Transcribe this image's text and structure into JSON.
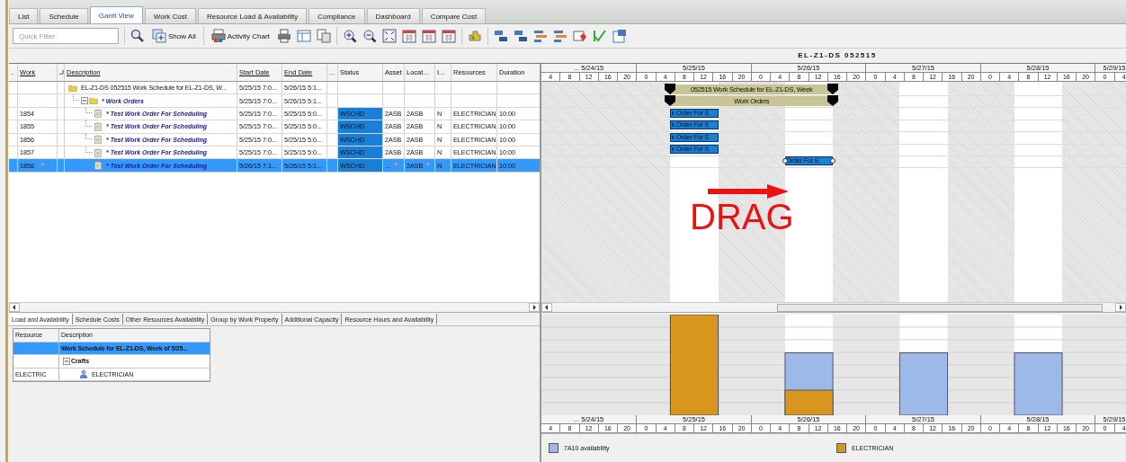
{
  "tabs": [
    {
      "label": "List",
      "selected": false
    },
    {
      "label": "Schedule",
      "selected": false
    },
    {
      "label": "Gantt View",
      "selected": true
    },
    {
      "label": "Work Cost",
      "selected": false
    },
    {
      "label": "Resource Load & Availability",
      "selected": false
    },
    {
      "label": "Compliance",
      "selected": false
    },
    {
      "label": "Dashboard",
      "selected": false
    },
    {
      "label": "Compare Cost",
      "selected": false
    }
  ],
  "toolbar": {
    "quick_filter": {
      "placeholder": "Quick Filter"
    },
    "buttons": [
      {
        "label": "Show All"
      },
      {
        "label": "Activity Chart"
      }
    ]
  },
  "schedule_title": "EL-Z1-DS 052515",
  "grid": {
    "columns": [
      {
        "label": ".."
      },
      {
        "label": "Work",
        "sortable": true
      },
      {},
      {
        "label": "Description",
        "sortable": true
      },
      {
        "label": "Start Date",
        "sortable": true
      },
      {
        "label": "End Date",
        "sortable": true
      },
      {
        "label": "..."
      },
      {
        "label": "Status"
      },
      {
        "label": "Asset"
      },
      {
        "label": "Locat..."
      },
      {
        "label": "I..."
      },
      {
        "label": "Resources"
      },
      {
        "label": "Duration"
      }
    ],
    "rows": [
      {
        "kind": "schedule",
        "selected": false,
        "description": "EL-Z1-DS 052515  Work Schedule for EL-Z1-DS, W...",
        "start": "5/25/15 7:0...",
        "end": "5/26/15 5:1...",
        "children": [
          {
            "kind": "group",
            "selected": false,
            "description": "* Work Orders",
            "start": "5/25/15 7:0...",
            "end": "5/26/15 5:1...",
            "children": [
              {
                "kind": "work_order",
                "selected": false,
                "work": "1854",
                "description": "* Test Work Order For Scheduling",
                "start": "5/25/15 7:0...",
                "end": "5/25/15 5:0...",
                "status": "WSCHD",
                "asset": "2ASB",
                "location": "2ASB",
                "i": "N",
                "resources": "ELECTRICIAN",
                "duration": "10:00",
                "linked": false
              },
              {
                "kind": "work_order",
                "selected": false,
                "work": "1855",
                "description": "* Test Work Order For Scheduling",
                "start": "5/25/15 7:0...",
                "end": "5/25/15 5:0...",
                "status": "WSCHD",
                "asset": "2ASB",
                "location": "2ASB",
                "i": "N",
                "resources": "ELECTRICIAN",
                "duration": "10:00",
                "linked": false
              },
              {
                "kind": "work_order",
                "selected": false,
                "work": "1856",
                "description": "* Test Work Order For Scheduling",
                "start": "5/25/15 7:0...",
                "end": "5/25/15 5:0...",
                "status": "WSCHD",
                "asset": "2ASB",
                "location": "2ASB",
                "i": "N",
                "resources": "ELECTRICIAN",
                "duration": "10:00",
                "linked": false
              },
              {
                "kind": "work_order",
                "selected": false,
                "work": "1857",
                "description": "* Test Work Order For Scheduling",
                "start": "5/25/15 7:0...",
                "end": "5/25/15 5:0...",
                "status": "WSCHD",
                "asset": "2ASB",
                "location": "2ASB",
                "i": "N",
                "resources": "ELECTRICIAN",
                "duration": "10:00",
                "linked": false
              },
              {
                "kind": "work_order",
                "selected": true,
                "work": "1858",
                "description": "* Test Work Order For Scheduling",
                "start": "5/26/15 7:1...",
                "end": "5/26/15 5:1...",
                "status": "WSCHD",
                "asset": "...",
                "location": "2ASB",
                "i": "N",
                "resources": "ELECTRICIAN",
                "duration": "10:00",
                "linked": true
              }
            ]
          }
        ]
      }
    ]
  },
  "gantt": {
    "timescale": [
      {
        "label": "... 5/24/15",
        "hours": [
          "4",
          "8",
          "12",
          "16",
          "20"
        ]
      },
      {
        "label": "5/25/15",
        "hours": [
          "0",
          "4",
          "8",
          "12",
          "16",
          "20"
        ]
      },
      {
        "label": "5/26/15",
        "hours": [
          "0",
          "4",
          "8",
          "12",
          "16",
          "20"
        ]
      },
      {
        "label": "5/27/15",
        "hours": [
          "0",
          "4",
          "8",
          "12",
          "16",
          "20"
        ]
      },
      {
        "label": "5/28/15",
        "hours": [
          "0",
          "4",
          "8",
          "12",
          "16",
          "20"
        ]
      },
      {
        "label": "5/29/15",
        "hours": [
          "0",
          "4"
        ]
      }
    ],
    "bars": [
      {
        "kind": "summary",
        "label": "052515  Work Schedule for EL-Z1-DS, Week"
      },
      {
        "kind": "summary",
        "label": "Work Orders"
      },
      {
        "kind": "task",
        "label": "k Order For S",
        "selected": false
      },
      {
        "kind": "task",
        "label": "k Order For S",
        "selected": false
      },
      {
        "kind": "task",
        "label": "k Order For S",
        "selected": false
      },
      {
        "kind": "task",
        "label": "k Order For S",
        "selected": false
      },
      {
        "kind": "task",
        "label": "Order For S",
        "selected": true
      }
    ],
    "annotation": {
      "label": "DRAG"
    }
  },
  "bottom_tabs": [
    {
      "label": "Load and Availability",
      "selected": true
    },
    {
      "label": "Schedule Costs",
      "selected": false
    },
    {
      "label": "Other Resources Availability",
      "selected": false
    },
    {
      "label": "Group by Work Property",
      "selected": false
    },
    {
      "label": "Additional Capacity",
      "selected": false
    },
    {
      "label": "Resource Hours and Availability",
      "selected": false
    }
  ],
  "resources": {
    "columns": [
      "Resource",
      "Description"
    ],
    "rows": [
      {
        "kind": "schedule",
        "selected": true,
        "description": "Work Schedule for EL-Z1-DS, Week of 5/25...",
        "children": [
          {
            "kind": "group",
            "selected": false,
            "description": "Crafts",
            "children": [
              {
                "kind": "craft",
                "selected": false,
                "resource": "ELECTRIC",
                "description": "ELECTRICIAN"
              }
            ]
          }
        ]
      }
    ]
  },
  "load_chart": {
    "series": [
      {
        "name": "7A10 availability",
        "color": "#9cb9e8"
      },
      {
        "name": "ELECTRICIAN",
        "color": "#d9961f"
      }
    ],
    "timescale": [
      {
        "label": "... 5/24/15",
        "hours": [
          "4",
          "8",
          "12",
          "16",
          "20"
        ]
      },
      {
        "label": "5/25/15",
        "hours": [
          "0",
          "4",
          "8",
          "12",
          "16",
          "20"
        ]
      },
      {
        "label": "5/26/15",
        "hours": [
          "0",
          "4",
          "8",
          "12",
          "16",
          "20"
        ]
      },
      {
        "label": "5/27/15",
        "hours": [
          "0",
          "4",
          "8",
          "12",
          "16",
          "20"
        ]
      },
      {
        "label": "5/28/15",
        "hours": [
          "0",
          "4",
          "8",
          "12",
          "16",
          "20"
        ]
      },
      {
        "label": "5/29/15",
        "hours": [
          "0",
          "4"
        ]
      }
    ]
  }
}
